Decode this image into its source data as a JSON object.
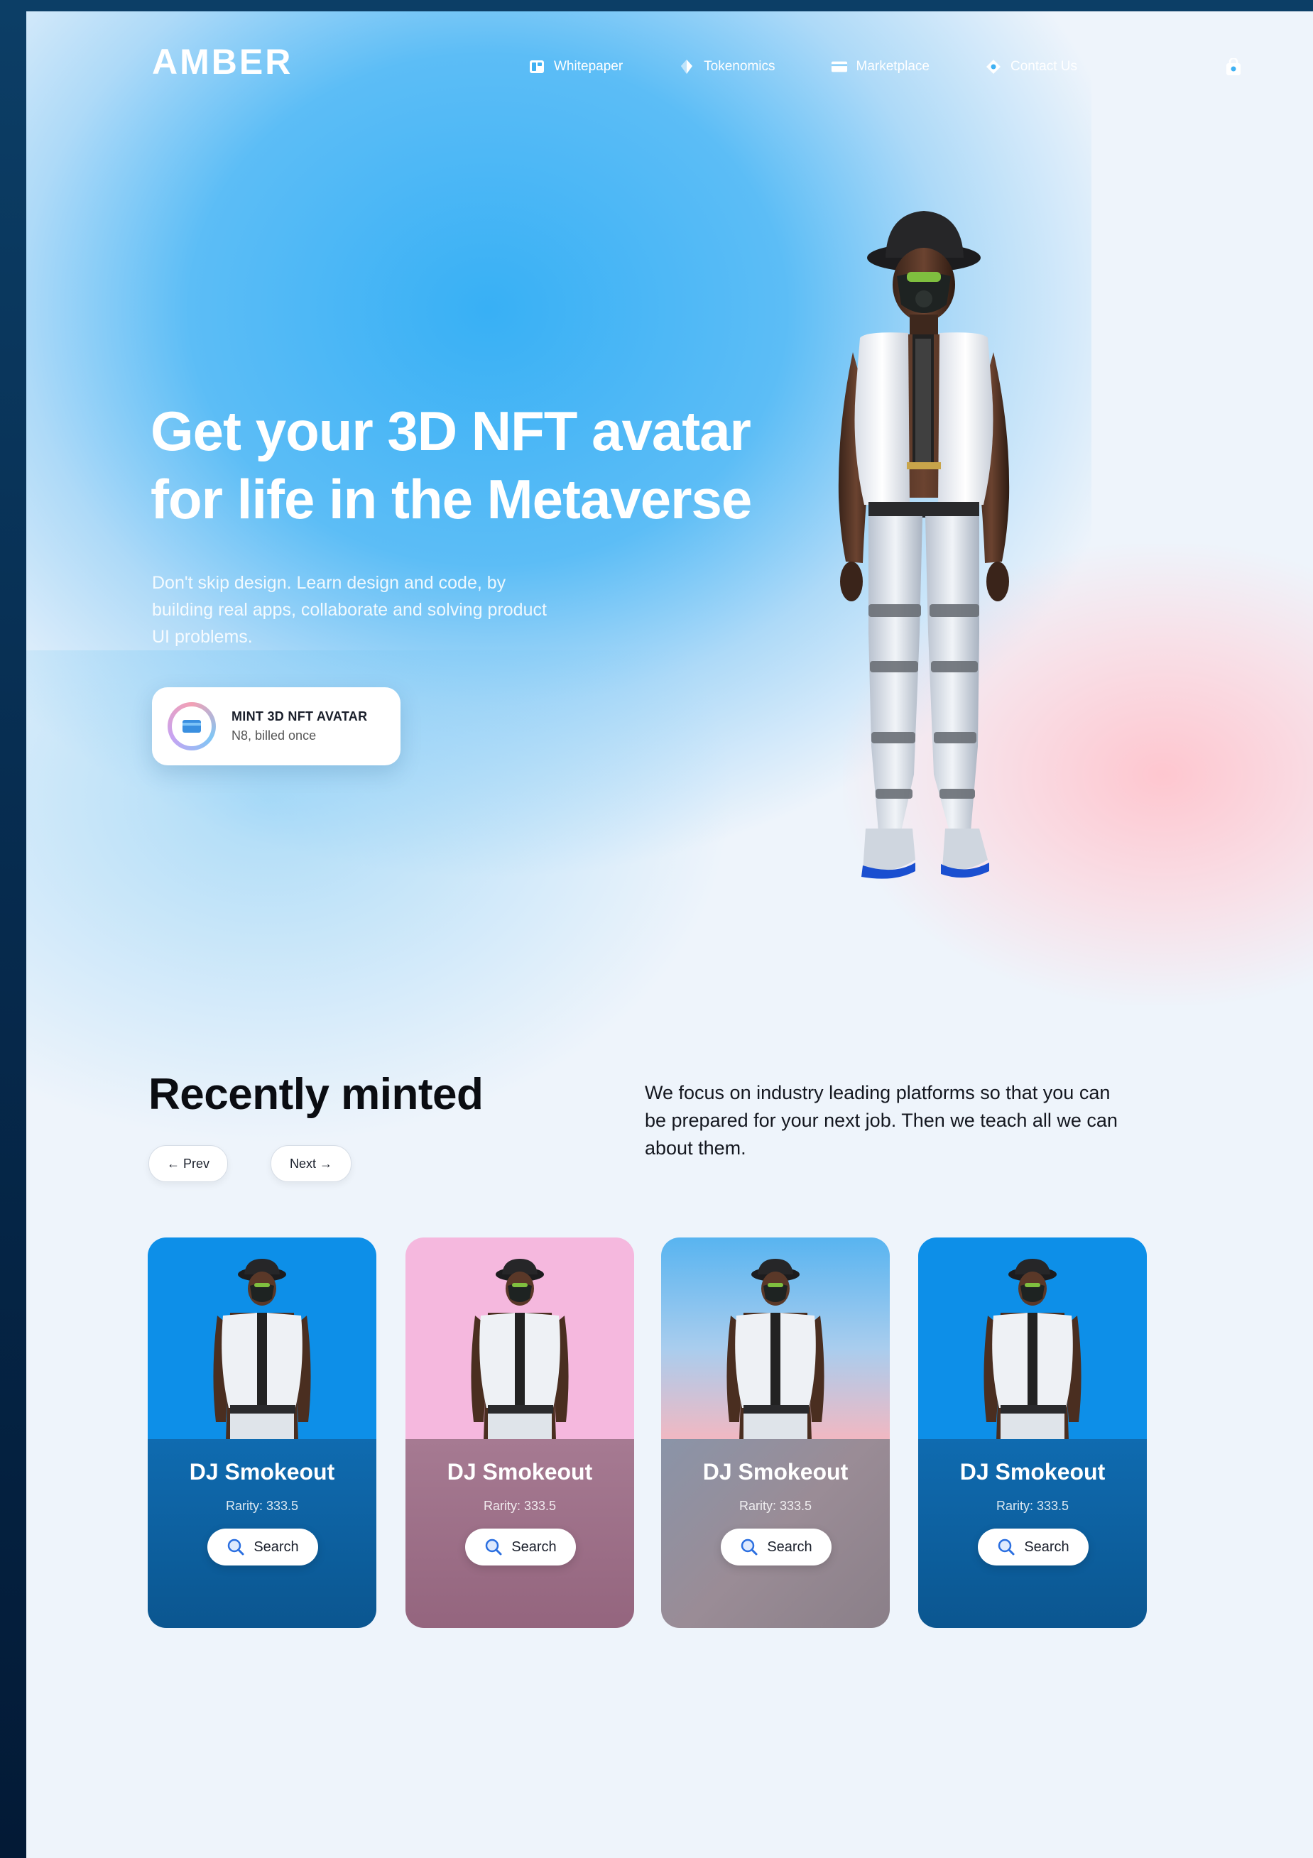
{
  "brand": {
    "logo": "AMBER"
  },
  "nav": {
    "items": [
      {
        "label": "Whitepaper",
        "icon": "document-icon"
      },
      {
        "label": "Tokenomics",
        "icon": "diamond-icon"
      },
      {
        "label": "Marketplace",
        "icon": "card-icon"
      },
      {
        "label": "Contact Us",
        "icon": "contact-icon"
      }
    ],
    "cart_icon": "bag-icon"
  },
  "hero": {
    "title_line1": "Get your 3D NFT avatar",
    "title_line2": "for life in the Metaverse",
    "subtitle": "Don't skip design. Learn design and code, by building real apps, collaborate and solving product UI problems.",
    "mint_button": {
      "title": "MINT 3D NFT AVATAR",
      "subtitle": "N8, billed once"
    }
  },
  "recent": {
    "title": "Recently minted",
    "prev_label": "← Prev",
    "next_label": "Next →",
    "description": "We focus on industry leading platforms so that you can be prepared for your next job. Then we teach all we can about them.",
    "cards": [
      {
        "name": "DJ Smokeout",
        "rarity": "Rarity: 333.5",
        "button": "Search"
      },
      {
        "name": "DJ Smokeout",
        "rarity": "Rarity: 333.5",
        "button": "Search"
      },
      {
        "name": "DJ Smokeout",
        "rarity": "Rarity: 333.5",
        "button": "Search"
      },
      {
        "name": "DJ Smokeout",
        "rarity": "Rarity: 333.5",
        "button": "Search"
      }
    ]
  },
  "colors": {
    "hero_blue": "#38b0f5",
    "card1_top": "#0d8fe8",
    "card1_bottom": "#0e5a94",
    "card2_top": "#f5b8de",
    "card2_bottom": "#9c6e86",
    "card3_bottom": "#8f8e9a",
    "card4_top": "#0d8fe8",
    "card4_bottom": "#0e5a94"
  }
}
